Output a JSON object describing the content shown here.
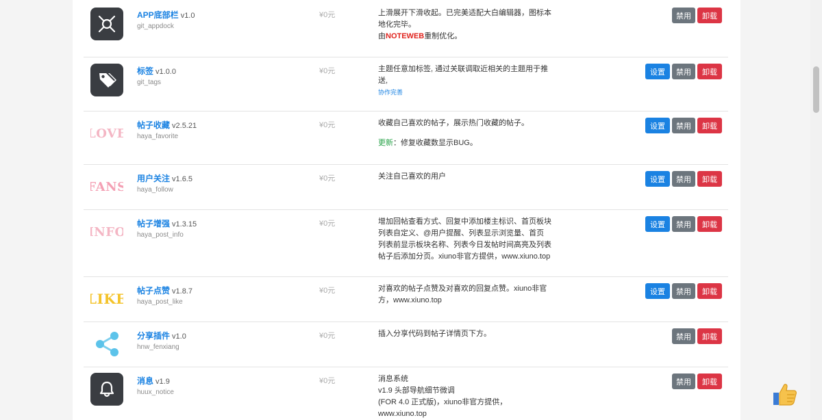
{
  "plugins": [
    {
      "name": "APP底部栏",
      "version": "v1.0",
      "id": "git_appdock",
      "price": "¥0元",
      "desc_lines": [
        "上滑展开下滑收起。已完美适配大白编辑器，图标本",
        "地化完毕。"
      ],
      "desc_prefix": "由",
      "desc_highlight": "NOTEWEB",
      "desc_suffix": "重制优化。",
      "icon": "dock-icon",
      "disable_label": "禁用",
      "uninstall_label": "卸载"
    },
    {
      "name": "标签",
      "version": "v1.0.0",
      "id": "git_tags",
      "price": "¥0元",
      "desc_lines": [
        "主题任意加标签, 通过关联调取近相关的主题用于推",
        "送,"
      ],
      "desc_sub": "协作完善",
      "icon": "tag-icon",
      "settings_label": "设置",
      "disable_label": "禁用",
      "uninstall_label": "卸载"
    },
    {
      "name": "帖子收藏",
      "version": "v2.5.21",
      "id": "haya_favorite",
      "price": "¥0元",
      "desc_lines": [
        "收藏自己喜欢的帖子，展示热门收藏的帖子。"
      ],
      "update_label": "更新",
      "update_text": "：修复收藏数显示BUG。",
      "logo_text": "LOVE",
      "settings_label": "设置",
      "disable_label": "禁用",
      "uninstall_label": "卸载"
    },
    {
      "name": "用户关注",
      "version": "v1.6.5",
      "id": "haya_follow",
      "price": "¥0元",
      "desc_lines": [
        "关注自己喜欢的用户"
      ],
      "logo_text": "FANS",
      "settings_label": "设置",
      "disable_label": "禁用",
      "uninstall_label": "卸载"
    },
    {
      "name": "帖子增强",
      "version": "v1.3.15",
      "id": "haya_post_info",
      "price": "¥0元",
      "desc_lines": [
        "增加回帖查看方式、回复中添加楼主标识、首页板块",
        "列表自定义、@用户提醒、列表显示浏览量、首页",
        "列表前显示板块名称、列表今日发帖时间高亮及列表",
        "帖子后添加分页。xiuno非官方提供，www.xiuno.top"
      ],
      "logo_text": "INFO",
      "settings_label": "设置",
      "disable_label": "禁用",
      "uninstall_label": "卸载"
    },
    {
      "name": "帖子点赞",
      "version": "v1.8.7",
      "id": "haya_post_like",
      "price": "¥0元",
      "desc_lines": [
        "对喜欢的帖子点赞及对喜欢的回复点赞。xiuno非官",
        "方，www.xiuno.top"
      ],
      "logo_text": "LIKE",
      "settings_label": "设置",
      "disable_label": "禁用",
      "uninstall_label": "卸载"
    },
    {
      "name": "分享插件",
      "version": "v1.0",
      "id": "hnw_fenxiang",
      "price": "¥0元",
      "desc_lines": [
        "插入分享代码到帖子详情页下方。"
      ],
      "icon": "share-icon",
      "disable_label": "禁用",
      "uninstall_label": "卸载"
    },
    {
      "name": "消息",
      "version": "v1.9",
      "id": "huux_notice",
      "price": "¥0元",
      "desc_lines": [
        "消息系统",
        "v1.9 头部导航细节微调",
        "(FOR 4.0 正式版)，xiuno非官方提供，",
        "www.xiuno.top"
      ],
      "icon": "bell-icon",
      "disable_label": "禁用",
      "uninstall_label": "卸载"
    }
  ],
  "colors": {
    "link": "#1a82e2",
    "btn_settings": "#1a82e2",
    "btn_disable": "#6c757d",
    "btn_uninstall": "#dc3545",
    "highlight": "#e0231d",
    "update": "#2aa34a"
  },
  "floating_icon": "thumbs-up-icon"
}
